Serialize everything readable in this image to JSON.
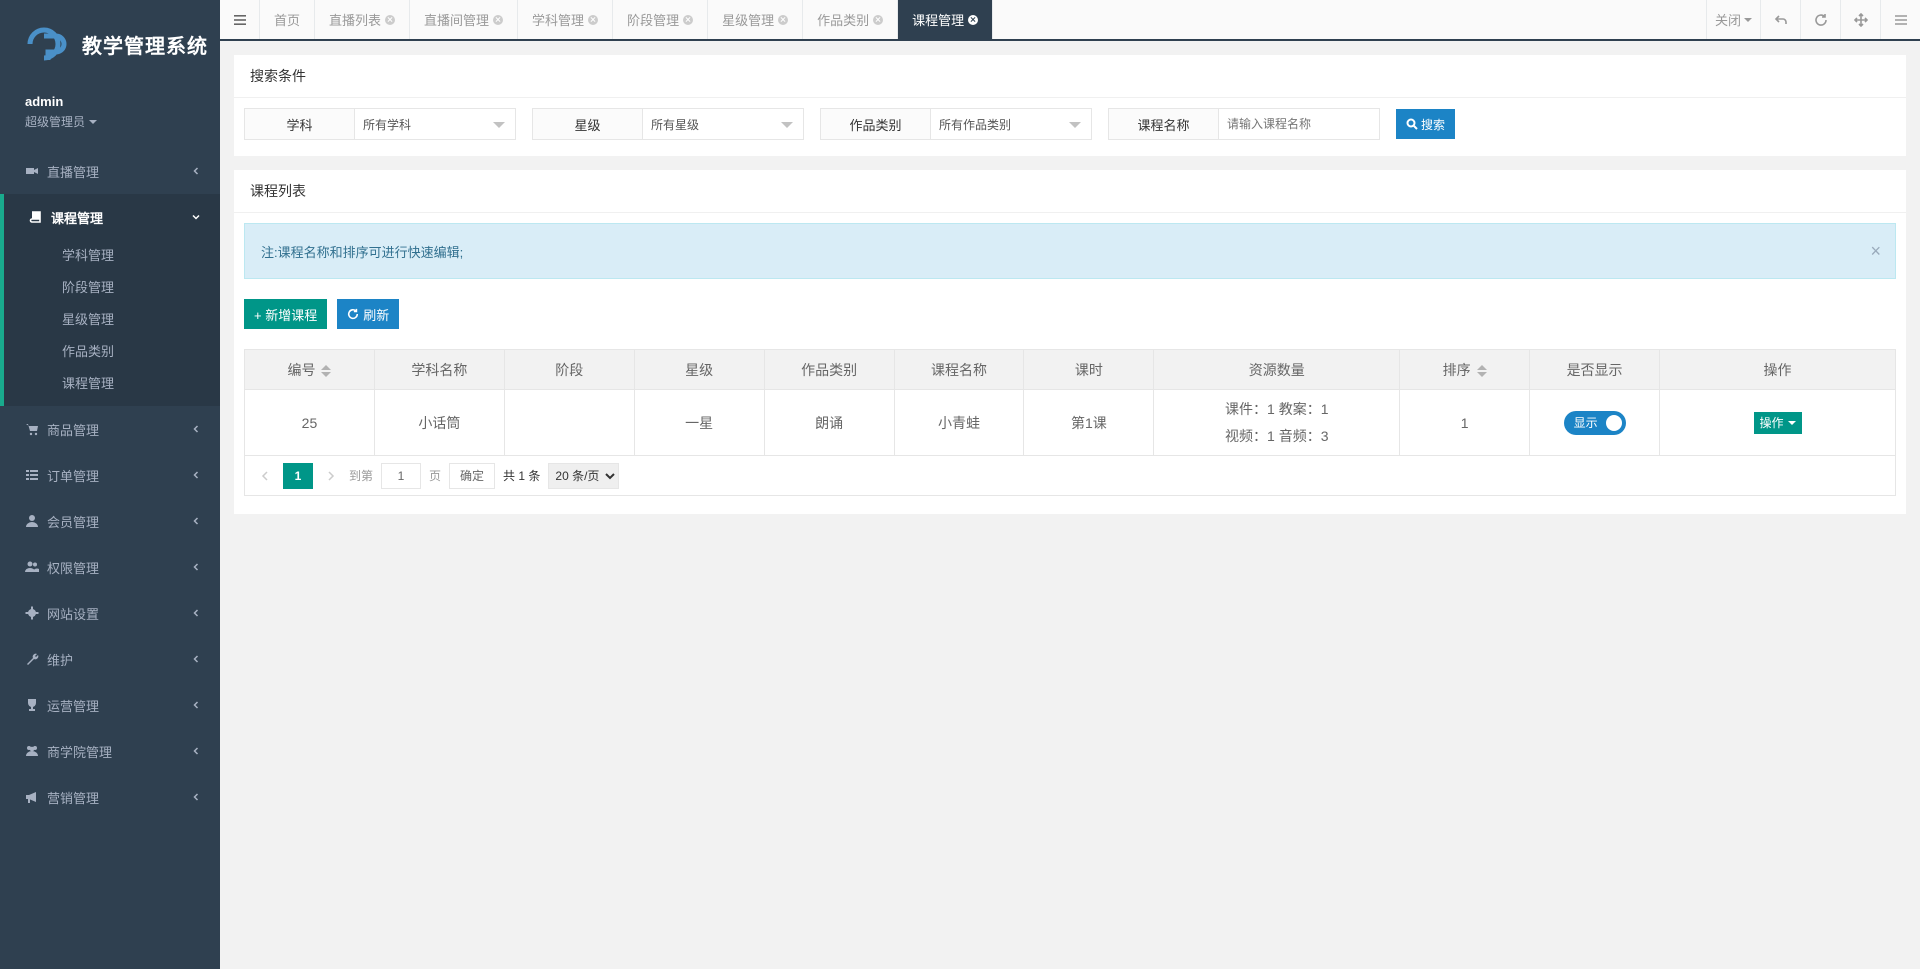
{
  "app": {
    "title": "教学管理系统"
  },
  "user": {
    "name": "admin",
    "role": "超级管理员"
  },
  "sidebar": {
    "groups": [
      {
        "label": "直播管理",
        "icon": "video-icon"
      },
      {
        "label": "课程管理",
        "icon": "book-icon",
        "active": true,
        "children": [
          "学科管理",
          "阶段管理",
          "星级管理",
          "作品类别",
          "课程管理"
        ]
      },
      {
        "label": "商品管理",
        "icon": "cart-icon"
      },
      {
        "label": "订单管理",
        "icon": "list-icon"
      },
      {
        "label": "会员管理",
        "icon": "user-icon"
      },
      {
        "label": "权限管理",
        "icon": "users-icon"
      },
      {
        "label": "网站设置",
        "icon": "gear-icon"
      },
      {
        "label": "维护",
        "icon": "wrench-icon"
      },
      {
        "label": "运营管理",
        "icon": "trophy-icon"
      },
      {
        "label": "商学院管理",
        "icon": "group-icon"
      },
      {
        "label": "营销管理",
        "icon": "megaphone-icon"
      }
    ]
  },
  "tabs": [
    "首页",
    "直播列表",
    "直播间管理",
    "学科管理",
    "阶段管理",
    "星级管理",
    "作品类别",
    "课程管理"
  ],
  "topbar": {
    "close_label": "关闭"
  },
  "search": {
    "title": "搜索条件",
    "subject": {
      "label": "学科",
      "value": "所有学科"
    },
    "star": {
      "label": "星级",
      "value": "所有星级"
    },
    "category": {
      "label": "作品类别",
      "value": "所有作品类别"
    },
    "course_name": {
      "label": "课程名称",
      "placeholder": "请输入课程名称"
    },
    "button": "搜索"
  },
  "list": {
    "title": "课程列表",
    "notice": "注:课程名称和排序可进行快速编辑;",
    "add_button": "+ 新增课程",
    "refresh_button": "刷新",
    "columns": [
      "编号",
      "学科名称",
      "阶段",
      "星级",
      "作品类别",
      "课程名称",
      "课时",
      "资源数量",
      "排序",
      "是否显示",
      "操作"
    ],
    "rows": [
      {
        "id": "25",
        "subject": "小话筒",
        "stage": "",
        "star": "一星",
        "category": "朗诵",
        "course": "小青蛙",
        "lesson": "第1课",
        "res1": "课件：1  教案：1",
        "res2": "视频：1  音频：3",
        "order": "1",
        "show": "显示",
        "op": "操作"
      }
    ]
  },
  "pager": {
    "current": "1",
    "goto": "到第",
    "page_input": "1",
    "page_unit": "页",
    "ok": "确定",
    "total": "共 1 条",
    "per_page": "20 条/页"
  },
  "colors": {
    "sidebar": "#2f4050",
    "primary": "#1c84c6",
    "teal": "#009688"
  }
}
